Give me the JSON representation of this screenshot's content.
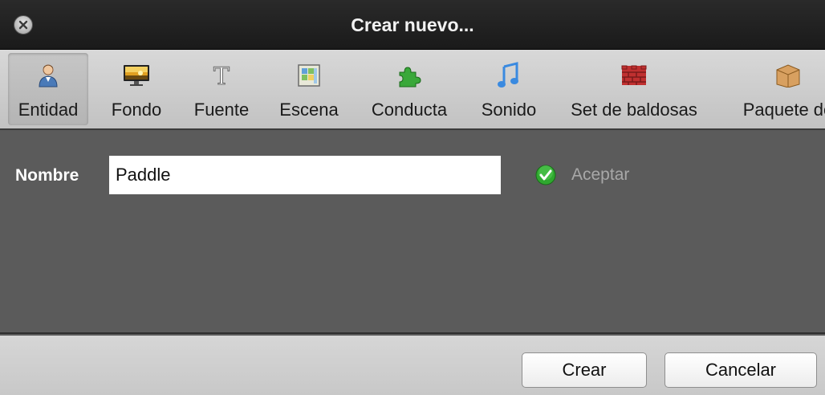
{
  "window": {
    "title": "Crear nuevo..."
  },
  "toolbar": {
    "items": [
      {
        "label": "Entidad",
        "icon": "entity-person-icon",
        "selected": true
      },
      {
        "label": "Fondo",
        "icon": "background-monitor-icon"
      },
      {
        "label": "Fuente",
        "icon": "font-T-icon"
      },
      {
        "label": "Escena",
        "icon": "scene-grid-icon"
      },
      {
        "label": "Conducta",
        "icon": "behavior-puzzle-icon"
      },
      {
        "label": "Sonido",
        "icon": "sound-music-note-icon"
      },
      {
        "label": "Set de baldosas",
        "icon": "tileset-bricks-icon"
      },
      {
        "label": "Paquete de",
        "icon": "package-box-icon"
      }
    ]
  },
  "form": {
    "name_label": "Nombre",
    "name_value": "Paddle",
    "accept_label": "Aceptar"
  },
  "footer": {
    "create_label": "Crear",
    "cancel_label": "Cancelar"
  },
  "colors": {
    "titlebar": "#1f1f1f",
    "toolbar": "#cfcfcf",
    "content": "#5b5b5b",
    "accept_check": "#2fa82f"
  }
}
